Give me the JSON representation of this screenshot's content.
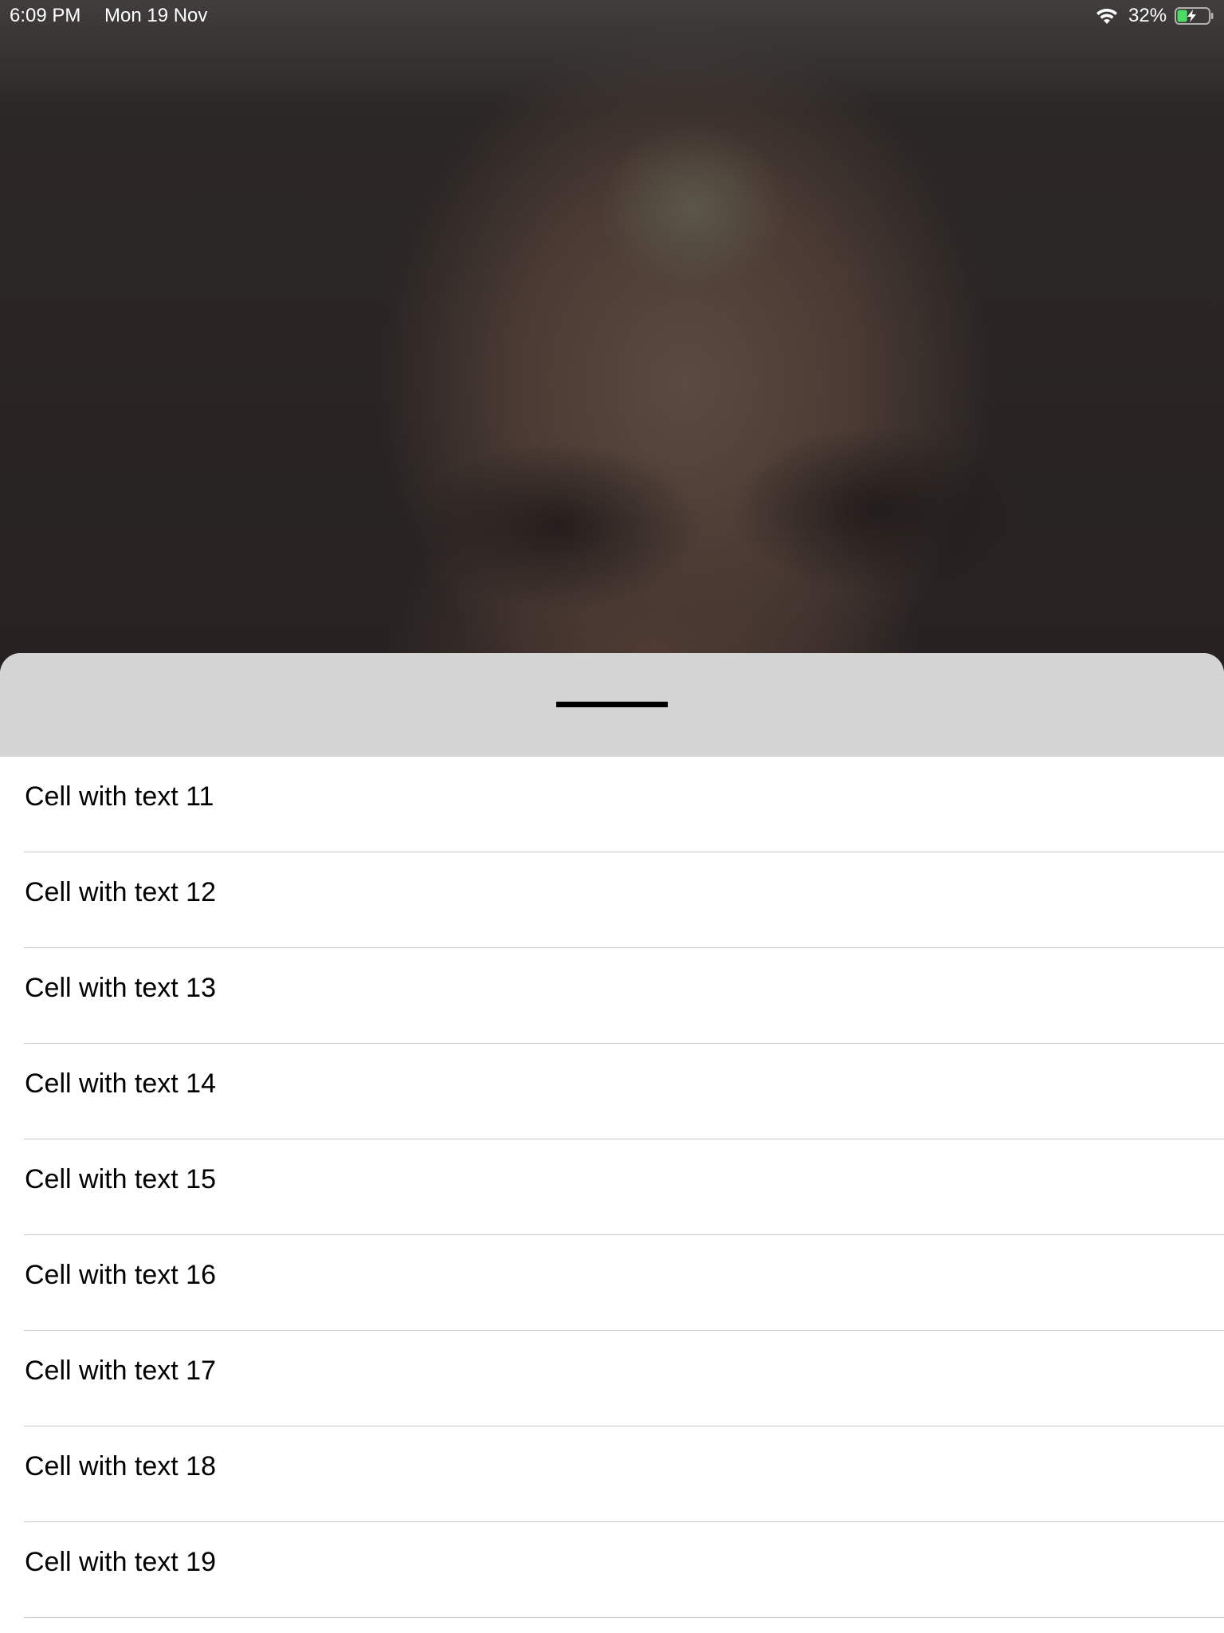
{
  "status_bar": {
    "time": "6:09 PM",
    "date": "Mon 19 Nov",
    "battery_percent": "32%",
    "battery_level": 0.32,
    "battery_charging": true,
    "wifi_icon": "wifi-icon",
    "battery_icon": "battery-charging-icon"
  },
  "sheet": {
    "header_color": "#d4d4d4",
    "handle_icon": "drag-handle",
    "cells": [
      {
        "label": "Cell with text 11"
      },
      {
        "label": "Cell with text 12"
      },
      {
        "label": "Cell with text 13"
      },
      {
        "label": "Cell with text 14"
      },
      {
        "label": "Cell with text 15"
      },
      {
        "label": "Cell with text 16"
      },
      {
        "label": "Cell with text 17"
      },
      {
        "label": "Cell with text 18"
      },
      {
        "label": "Cell with text 19"
      }
    ]
  }
}
